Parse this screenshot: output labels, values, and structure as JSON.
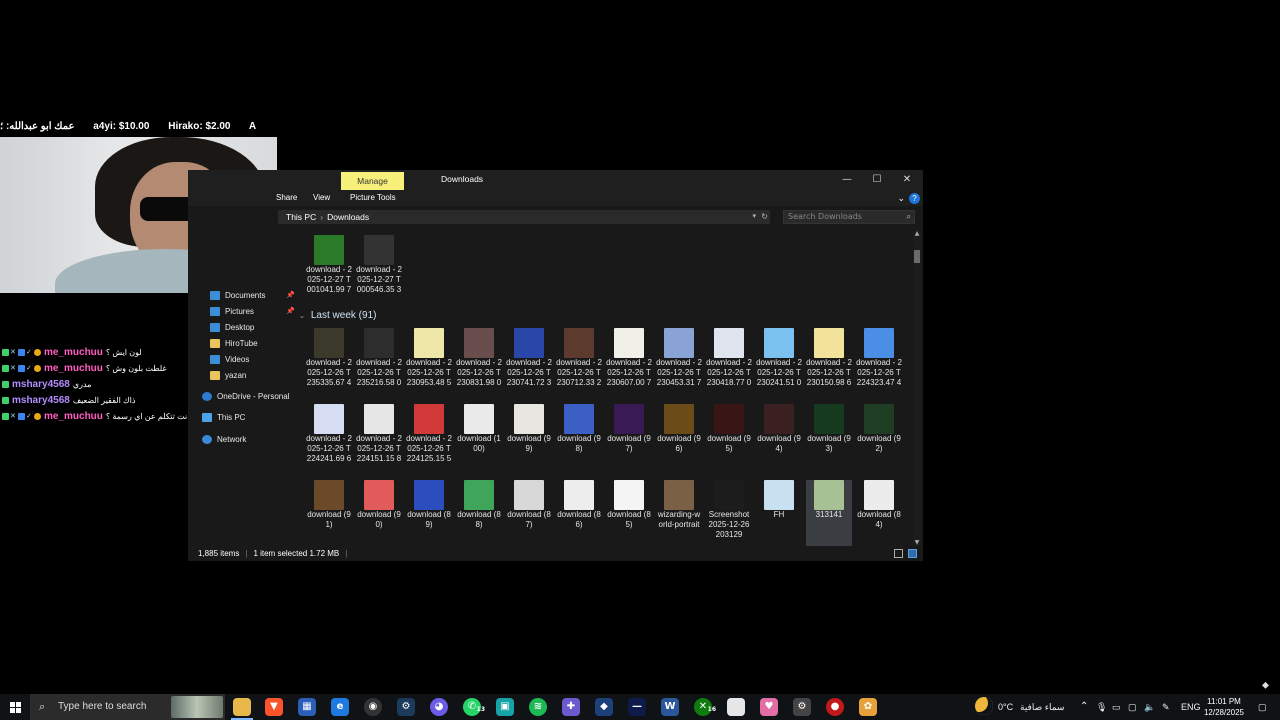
{
  "overlay": {
    "ticker": [
      "عمك ابو عبدالله: ؛",
      "a4yi: $10.00",
      "Hirako: $2.00",
      "A"
    ],
    "chat": [
      {
        "user": "me_muchuu",
        "msg": "لون ايش ؟",
        "color": "#ff5ec4"
      },
      {
        "user": "me_muchuu",
        "msg": "غلطت بلون وش ؟",
        "color": "#ff5ec4"
      },
      {
        "user": "mshary4568",
        "msg": "مدري",
        "color": "#b48cff"
      },
      {
        "user": "mshary4568",
        "msg": "ذاك الفقير الضعيف",
        "color": "#b48cff"
      },
      {
        "user": "me_muchuu",
        "msg": "انت تتكلم عن اي رسمة ؟",
        "color": "#ff5ec4"
      }
    ]
  },
  "explorer": {
    "manage_tab": "Manage",
    "window_title": "Downloads",
    "ribbon_tabs": [
      "Share",
      "View",
      "Picture Tools"
    ],
    "breadcrumb": [
      "This PC",
      "Downloads"
    ],
    "search_placeholder": "Search Downloads",
    "nav": [
      {
        "label": "Documents",
        "icon": "documents-icon",
        "pinned": true
      },
      {
        "label": "Pictures",
        "icon": "pictures-icon",
        "pinned": true
      },
      {
        "label": "Desktop",
        "icon": "folder-icon",
        "pinned": false
      },
      {
        "label": "HiroTube",
        "icon": "folder-icon",
        "pinned": false
      },
      {
        "label": "Videos",
        "icon": "videos-icon",
        "pinned": false
      },
      {
        "label": "yazan",
        "icon": "folder-icon",
        "pinned": false
      },
      {
        "label": "OneDrive - Personal",
        "icon": "onedrive-icon",
        "pinned": false
      },
      {
        "label": "This PC",
        "icon": "this-pc-icon",
        "pinned": false
      },
      {
        "label": "Network",
        "icon": "network-icon",
        "pinned": false
      }
    ],
    "group_label": "Last week (91)",
    "files_top": [
      {
        "name": "download - 2025-12-27 T001041.99 7",
        "thumb": "#2a7a2a"
      },
      {
        "name": "download - 2025-12-27 T000546.35 3",
        "thumb": "#333333"
      }
    ],
    "files_row1": [
      {
        "name": "download - 2025-12-26 T235335.67 4",
        "thumb": "#3b3a2a"
      },
      {
        "name": "download - 2025-12-26 T235216.58 0",
        "thumb": "#2d2d2d"
      },
      {
        "name": "download - 2025-12-26 T230953.48 5",
        "thumb": "#efe7a8"
      },
      {
        "name": "download - 2025-12-26 T230831.98 0",
        "thumb": "#6a4e4e"
      },
      {
        "name": "download - 2025-12-26 T230741.72 3",
        "thumb": "#2847a8"
      },
      {
        "name": "download - 2025-12-26 T230712.33 2",
        "thumb": "#5d3a2e"
      },
      {
        "name": "download - 2025-12-26 T230607.00 7",
        "thumb": "#f0efe8"
      },
      {
        "name": "download - 2025-12-26 T230453.31 7",
        "thumb": "#8aa3d6"
      },
      {
        "name": "download - 2025-12-26 T230418.77 0",
        "thumb": "#dfe4ef"
      },
      {
        "name": "download - 2025-12-26 T230241.51 0",
        "thumb": "#7bc1f0"
      },
      {
        "name": "download - 2025-12-26 T230150.98 6",
        "thumb": "#f1e39a"
      },
      {
        "name": "download - 2025-12-26 T224323.47 4",
        "thumb": "#4b8ee6"
      }
    ],
    "files_row2": [
      {
        "name": "download - 2025-12-26 T224241.69 6",
        "thumb": "#d6dcf2"
      },
      {
        "name": "download - 2025-12-26 T224151.15 8",
        "thumb": "#e6e6e6"
      },
      {
        "name": "download - 2025-12-26 T224125.15 5",
        "thumb": "#d23a3a"
      },
      {
        "name": "download (100)",
        "thumb": "#eaeaea"
      },
      {
        "name": "download (99)",
        "thumb": "#e8e6e0"
      },
      {
        "name": "download (98)",
        "thumb": "#3b5fc4"
      },
      {
        "name": "download (97)",
        "thumb": "#3a1a55"
      },
      {
        "name": "download (96)",
        "thumb": "#6b4b18"
      },
      {
        "name": "download (95)",
        "thumb": "#3a1515"
      },
      {
        "name": "download (94)",
        "thumb": "#3a2020"
      },
      {
        "name": "download (93)",
        "thumb": "#163a1f"
      },
      {
        "name": "download (92)",
        "thumb": "#1e3d22"
      }
    ],
    "files_row3": [
      {
        "name": "download (91)",
        "thumb": "#6b4a2a"
      },
      {
        "name": "download (90)",
        "thumb": "#e25b5b"
      },
      {
        "name": "download (89)",
        "thumb": "#2c4dbd"
      },
      {
        "name": "download (88)",
        "thumb": "#3fa55a"
      },
      {
        "name": "download (87)",
        "thumb": "#d8d8d8"
      },
      {
        "name": "download (86)",
        "thumb": "#ededed"
      },
      {
        "name": "download (85)",
        "thumb": "#f4f4f4"
      },
      {
        "name": "wizarding-world-portrait",
        "thumb": "#7a6145"
      },
      {
        "name": "Screenshot 2025-12-26 203129",
        "thumb": "#1c1c1c"
      },
      {
        "name": "FH",
        "thumb": "#c8e0f0"
      },
      {
        "name": "313141",
        "thumb": "#a6c294",
        "selected": true
      },
      {
        "name": "download (84)",
        "thumb": "#ececec"
      }
    ],
    "status": {
      "items": "1,885 items",
      "selected": "1 item selected  1.72 MB"
    }
  },
  "taskbar": {
    "search_placeholder": "Type here to search",
    "whatsapp_badge": "13",
    "xbox_badge": "16",
    "weather_temp": "0°C",
    "weather_desc": "سماء صافية",
    "language": "ENG",
    "time": "11:01 PM",
    "date": "12/28/2025"
  }
}
